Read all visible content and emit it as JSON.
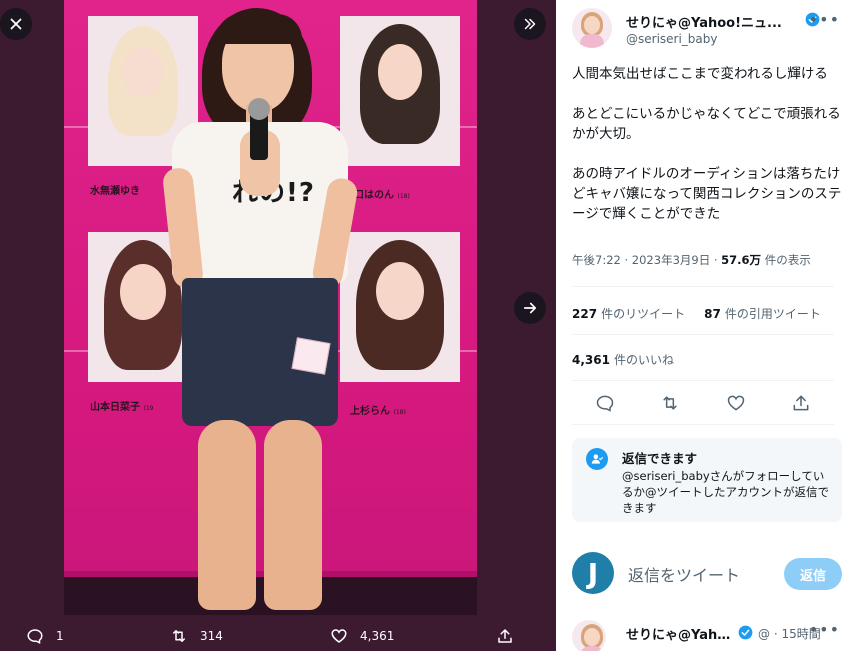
{
  "viewer": {
    "close_label": "×",
    "poster_names": [
      {
        "name": "水無瀬ゆき",
        "age": ""
      },
      {
        "name": "口はのん",
        "age": "(18)"
      },
      {
        "name": "山本日菜子",
        "age": "(19"
      },
      {
        "name": "上杉らん",
        "age": "(18)"
      }
    ],
    "shirt_text": "れの!?",
    "actions": {
      "replies": "1",
      "retweets": "314",
      "likes": "4,361"
    }
  },
  "tweet": {
    "display_name": "せりにゃ@Yahoo!ニュ...",
    "handle": "@seriseri_baby",
    "body": [
      "人間本気出せばここまで変われるし輝ける",
      "あとどこにいるかじゃなくてどこで頑張れるかが大切。",
      "あの時アイドルのオーディションは落ちたけどキャバ嬢になって関西コレクションのステージで輝くことができた"
    ],
    "time": "午後7:22",
    "date": "2023年3月9日",
    "views": "57.6万",
    "views_label": "件の表示",
    "retweets": "227",
    "retweets_label": "件のリツイート",
    "quotes": "87",
    "quotes_label": "件の引用ツイート",
    "likes": "4,361",
    "likes_label": "件のいいね"
  },
  "notice": {
    "title": "返信できます",
    "text": "@seriseri_babyさんがフォローしているか@ツイートしたアカウントが返信できます"
  },
  "reply": {
    "avatar_letter": "J",
    "placeholder": "返信をツイート",
    "button": "返信"
  },
  "next_tweet": {
    "display_name": "せりにゃ@Yaho...",
    "handle": "@",
    "time": "15時間"
  },
  "colors": {
    "accent": "#1d9bf0",
    "reply_button": "#8ecdf8",
    "viewer_bg": "#3c1a30",
    "poster": "#d81a84"
  }
}
